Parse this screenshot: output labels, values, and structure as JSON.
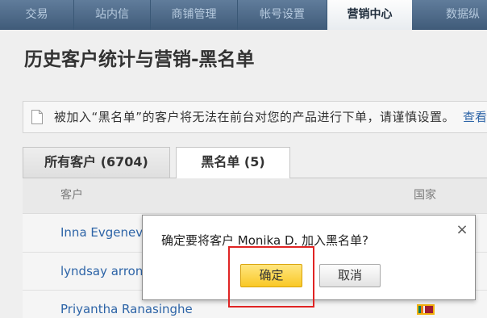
{
  "nav": {
    "tabs": [
      {
        "label": "交易",
        "active": false
      },
      {
        "label": "站内信",
        "active": false
      },
      {
        "label": "商铺管理",
        "active": false
      },
      {
        "label": "帐号设置",
        "active": false
      },
      {
        "label": "营销中心",
        "active": true
      },
      {
        "label": "数据纵",
        "active": false
      }
    ]
  },
  "page": {
    "title": "历史客户统计与营销-黑名单"
  },
  "notice": {
    "icon": "document-icon",
    "text": "被加入“黑名单”的客户将无法在前台对您的产品进行下单，请谨慎设置。",
    "link_label": "查看"
  },
  "tabs": [
    {
      "label": "所有客户 (6704)",
      "active": false
    },
    {
      "label": "黑名单 (5)",
      "active": true
    }
  ],
  "table": {
    "columns": {
      "customer": "客户",
      "country": "国家"
    },
    "rows": [
      {
        "customer": "Inna Evgenev"
      },
      {
        "customer": "lyndsay arron"
      },
      {
        "customer": "Priyantha Ranasinghe",
        "flag": {
          "icon": "flag-icon",
          "colors": {
            "border": "#f3b10c",
            "stripe_1": "#0a7a5a",
            "stripe_2": "#f07a12",
            "field": "#9c1c34"
          }
        }
      }
    ]
  },
  "dialog": {
    "message": "确定要将客户 Monika D. 加入黑名单?",
    "confirm_label": "确定",
    "cancel_label": "取消",
    "close_icon": "close-icon",
    "close_glyph": "×"
  },
  "colors": {
    "nav_background": "#4a6a8d",
    "nav_text": "#b6cade",
    "link": "#2d64a7",
    "confirm_button": "#f9c826",
    "annotation_border": "#e02424"
  }
}
